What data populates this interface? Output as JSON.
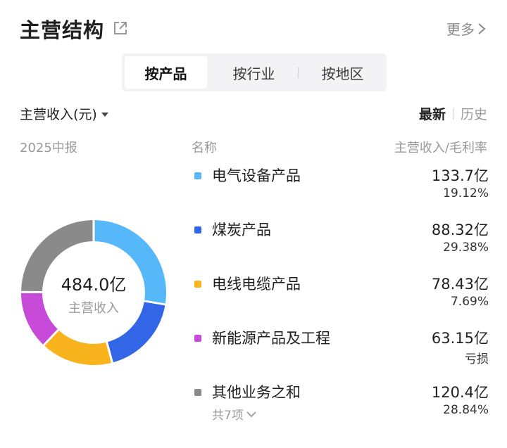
{
  "header": {
    "title": "主营结构",
    "more_label": "更多"
  },
  "tabs": [
    {
      "label": "按产品",
      "active": true
    },
    {
      "label": "按行业",
      "active": false
    },
    {
      "label": "按地区",
      "active": false
    }
  ],
  "metric_selector": {
    "label": "主营收入(元)"
  },
  "view_toggle": {
    "latest": "最新",
    "history": "历史"
  },
  "period_label": "2025中报",
  "columns": {
    "name": "名称",
    "revenue_margin": "主营收入/毛利率"
  },
  "donut_center": {
    "value": "484.0亿",
    "label": "主营收入"
  },
  "segments": [
    {
      "name": "电气设备产品",
      "revenue": "133.7亿",
      "margin": "19.12%",
      "value": 133.7,
      "color": "#56b8f8"
    },
    {
      "name": "煤炭产品",
      "revenue": "88.32亿",
      "margin": "29.38%",
      "value": 88.32,
      "color": "#3366e6"
    },
    {
      "name": "电线电缆产品",
      "revenue": "78.43亿",
      "margin": "7.69%",
      "value": 78.43,
      "color": "#f9b31c"
    },
    {
      "name": "新能源产品及工程",
      "revenue": "63.15亿",
      "margin": "亏损",
      "value": 63.15,
      "color": "#c74ad9"
    },
    {
      "name": "其他业务之和",
      "revenue": "120.4亿",
      "margin": "28.84%",
      "value": 120.4,
      "color": "#8a8a8a",
      "sub_label": "共7项"
    }
  ],
  "icons": {
    "external": "external-link-icon",
    "more": "chevron-right-icon",
    "dropdown": "caret-down-icon",
    "expand": "chevron-down-icon"
  }
}
